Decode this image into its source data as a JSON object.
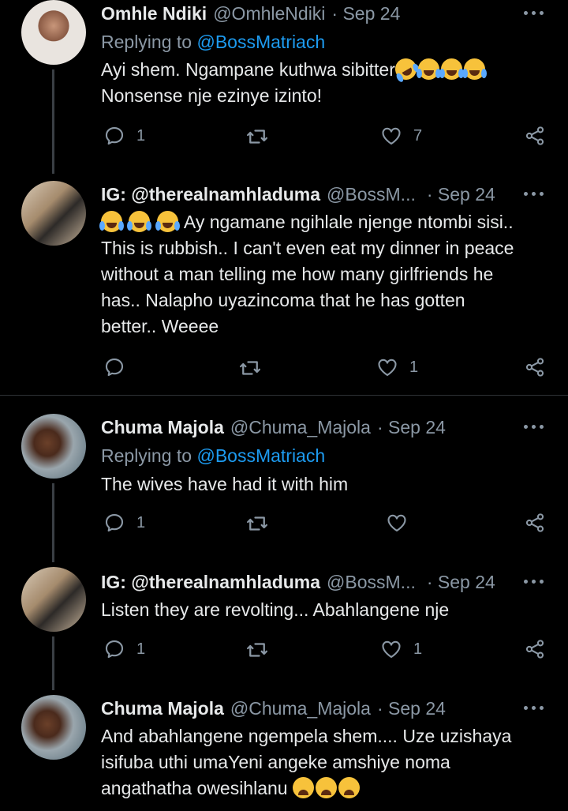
{
  "tweets": [
    {
      "name": "Omhle Ndiki",
      "handle": "@OmhleNdiki",
      "date": "· Sep 24",
      "replying_prefix": "Replying to",
      "replying_handle": "@BossMatriach",
      "lines": [
        "Ayi shem. Ngampane kuthwa sibitter",
        "Nonsense nje ezinye izinto!"
      ],
      "emoji_after_line1": [
        "rofl-emoji",
        "joy-emoji",
        "joy-emoji",
        "joy-emoji"
      ],
      "replies": "1",
      "retweets": "",
      "likes": "7"
    },
    {
      "name": "IG: @therealnamhladuma",
      "handle": "@BossM...",
      "date": "· Sep 24",
      "lines": [
        "Ay ngamane ngihlale njenge ntombi sisi..",
        "This is rubbish.. I can't even eat my dinner in peace",
        "without a man telling me how many girlfriends he",
        "has.. Nalapho uyazincoma that he has gotten",
        "better.. Weeee"
      ],
      "emoji_before_line1": [
        "joy-emoji",
        "joy-emoji",
        "joy-emoji"
      ],
      "replies": "",
      "retweets": "",
      "likes": "1"
    },
    {
      "name": "Chuma Majola",
      "handle": "@Chuma_Majola",
      "date": "· Sep 24",
      "replying_prefix": "Replying to",
      "replying_handle": "@BossMatriach",
      "lines": [
        "The wives have had it with him"
      ],
      "replies": "1",
      "retweets": "",
      "likes": ""
    },
    {
      "name": "IG: @therealnamhladuma",
      "handle": "@BossM...",
      "date": "· Sep 24",
      "lines": [
        "Listen they are revolting... Abahlangene nje"
      ],
      "replies": "1",
      "retweets": "",
      "likes": "1"
    },
    {
      "name": "Chuma Majola",
      "handle": "@Chuma_Majola",
      "date": "· Sep 24",
      "lines": [
        "And abahlangene ngempela shem.... Uze uzishaya",
        "isifuba uthi umaYeni angeke amshiye noma",
        "angathatha owesihlanu"
      ],
      "emoji_after_last": [
        "sob-emoji",
        "sob-emoji",
        "sob-emoji"
      ]
    }
  ],
  "colors": {
    "background": "#000000",
    "text": "#e7e9ea",
    "muted": "#8b98a5",
    "link": "#1d9bf0",
    "divider": "#2f3336"
  }
}
